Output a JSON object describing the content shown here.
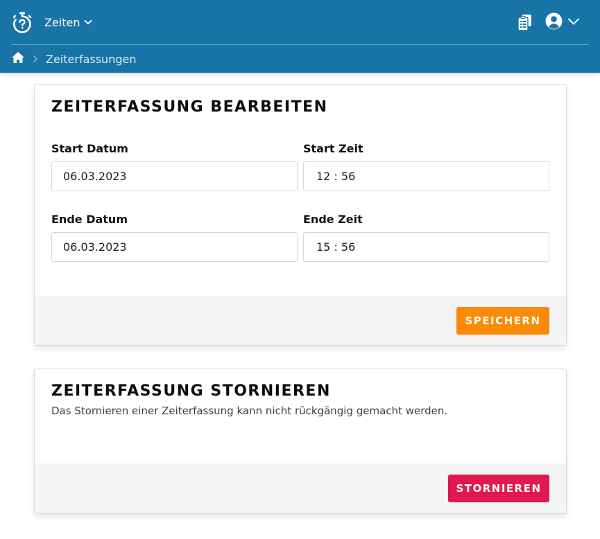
{
  "header": {
    "nav_label": "Zeiten",
    "icons": {
      "logo": "stopwatch-icon",
      "nav_chevron": "chevron-down-icon",
      "clipboard": "clipboard-icon",
      "user": "user-circle-icon",
      "user_chevron": "chevron-down-icon"
    },
    "colors": {
      "background": "#1874a6"
    }
  },
  "breadcrumb": {
    "home_icon": "home-icon",
    "separator_icon": "chevron-right-icon",
    "current": "Zeiterfassungen"
  },
  "edit_card": {
    "title": "ZEITERFASSUNG BEARBEITEN",
    "start_date": {
      "label": "Start Datum",
      "value": "06.03.2023"
    },
    "start_time": {
      "label": "Start Zeit",
      "value": "12 : 56"
    },
    "end_date": {
      "label": "Ende Datum",
      "value": "06.03.2023"
    },
    "end_time": {
      "label": "Ende Zeit",
      "value": "15 : 56"
    },
    "save_label": "SPEICHERN",
    "colors": {
      "save_button": "#fb8b06"
    }
  },
  "cancel_card": {
    "title": "ZEITERFASSUNG STORNIEREN",
    "description": "Das Stornieren einer Zeiterfassung kann nicht rückgängig gemacht werden.",
    "cancel_label": "STORNIEREN",
    "colors": {
      "cancel_button": "#e0184d"
    }
  }
}
